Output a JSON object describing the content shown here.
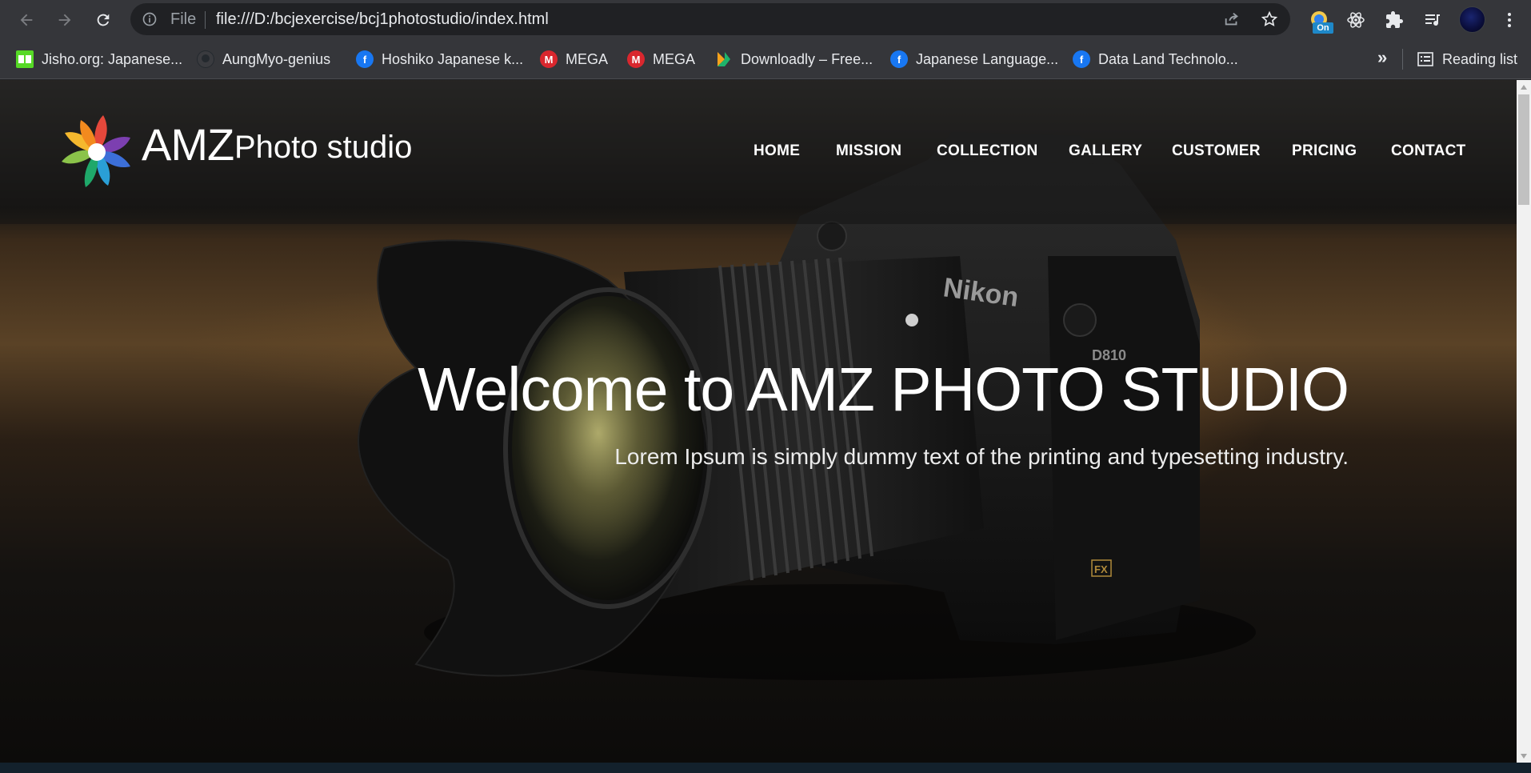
{
  "browser": {
    "omnibox": {
      "scheme_label": "File",
      "url": "file:///D:/bcjexercise/bcj1photostudio/index.html"
    },
    "extension_badge": "On",
    "bookmarks": [
      {
        "label": "Jisho.org: Japanese...",
        "icon": "jisho-icon",
        "color": "#56d926"
      },
      {
        "label": "AungMyo-genius",
        "icon": "github-icon",
        "color": "#24292e"
      },
      {
        "label": "Hoshiko Japanese k...",
        "icon": "facebook-icon",
        "color": "#1877f2"
      },
      {
        "label": "MEGA",
        "icon": "mega-icon",
        "color": "#d9272e"
      },
      {
        "label": "MEGA",
        "icon": "mega-icon",
        "color": "#d9272e"
      },
      {
        "label": "Downloadly – Free...",
        "icon": "downloadly-icon",
        "color": "#f7a21b"
      },
      {
        "label": "Japanese Language...",
        "icon": "facebook-icon",
        "color": "#1877f2"
      },
      {
        "label": "Data Land Technolo...",
        "icon": "facebook-icon",
        "color": "#1877f2"
      }
    ],
    "overflow_label": "»",
    "reading_list_label": "Reading list"
  },
  "site": {
    "logo": {
      "brand": "AMZ",
      "subtitle": "Photo studio"
    },
    "nav": [
      "HOME",
      "MISSION",
      "COLLECTION",
      "GALLERY",
      "CUSTOMER",
      "PRICING",
      "CONTACT"
    ],
    "hero": {
      "title": "Welcome to AMZ PHOTO STUDIO",
      "subtitle": "Lorem Ipsum is simply dummy text of the printing and typesetting industry."
    },
    "camera": {
      "brand_text": "Nikon",
      "model_text": "D810",
      "fx_text": "FX"
    }
  },
  "colors": {
    "chrome_bg": "#35363a",
    "omnibox_bg": "#202124",
    "page_bg": "#0a0908",
    "text_white": "#ffffff"
  }
}
